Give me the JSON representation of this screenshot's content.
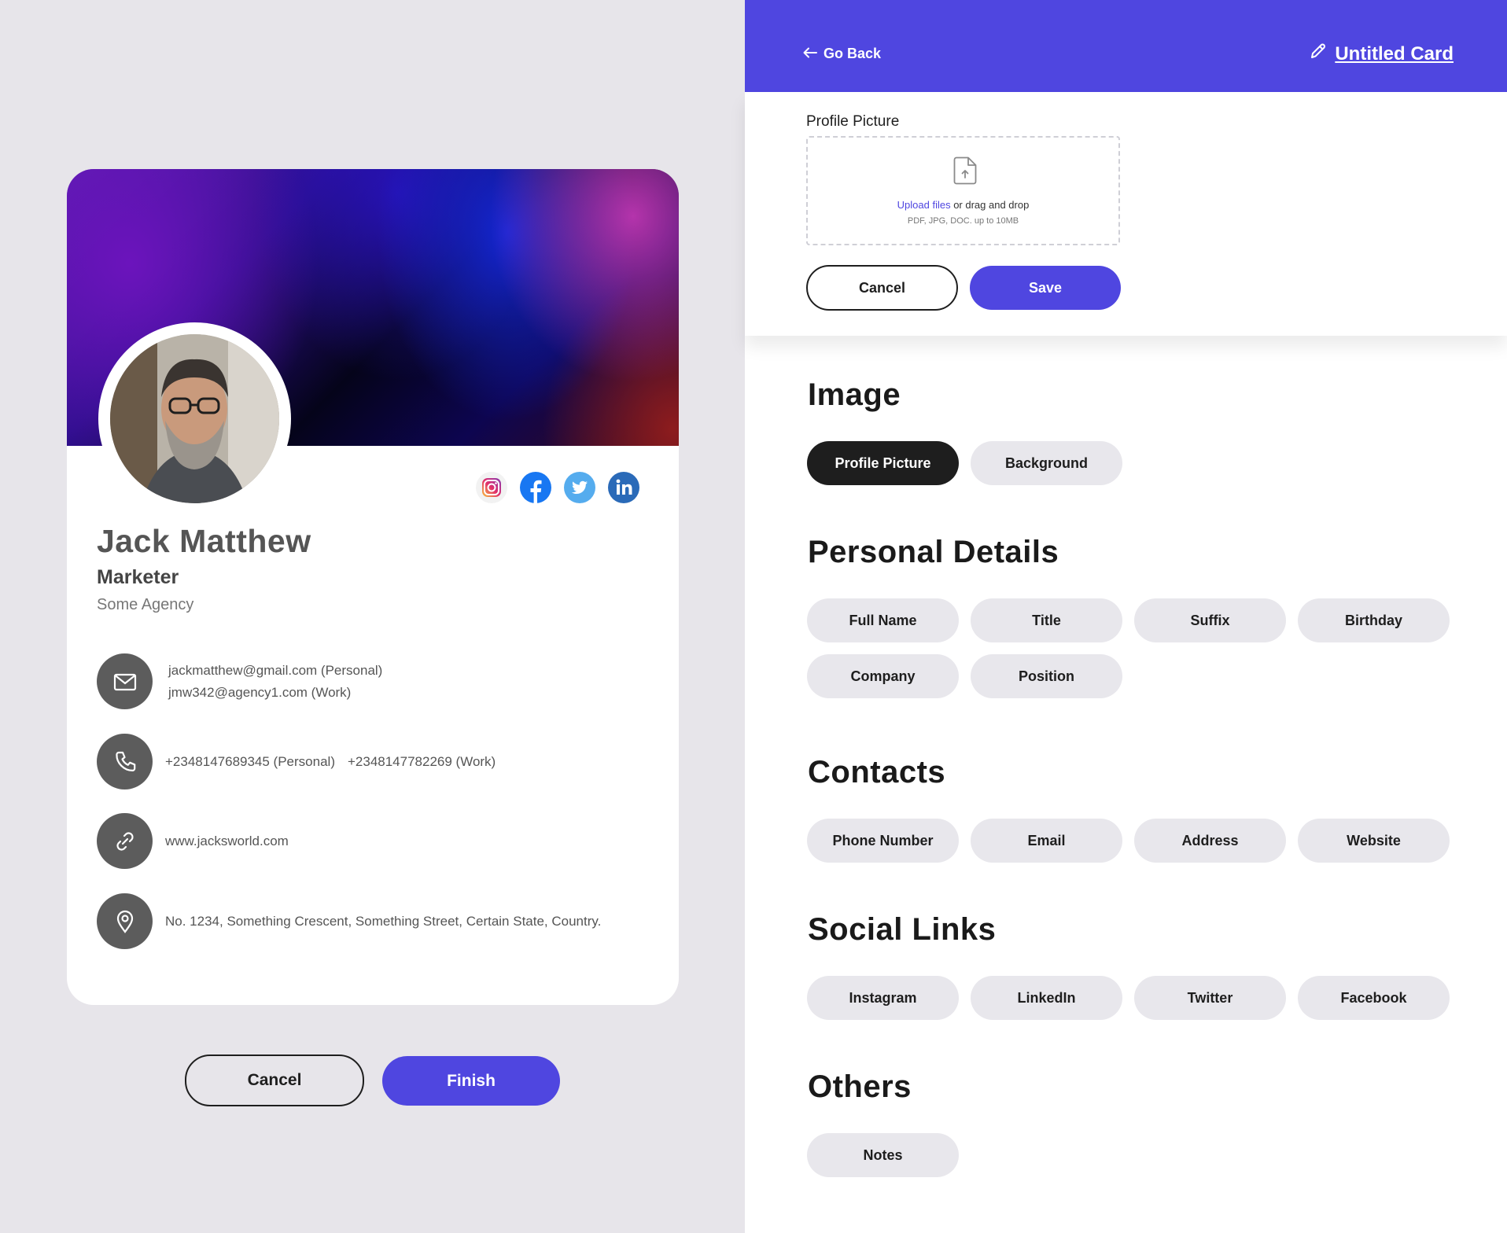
{
  "card": {
    "name": "Jack Matthew",
    "role": "Marketer",
    "agency": "Some Agency",
    "emails": [
      "jackmatthew@gmail.com (Personal)",
      "jmw342@agency1.com (Work)"
    ],
    "phones": [
      "+2348147689345 (Personal)",
      "+2348147782269 (Work)"
    ],
    "website": "www.jacksworld.com",
    "address": "No. 1234, Something Crescent, Something Street, Certain State, Country.",
    "socials": [
      "instagram-icon",
      "facebook-icon",
      "twitter-icon",
      "linkedin-icon"
    ]
  },
  "left_actions": {
    "cancel": "Cancel",
    "finish": "Finish"
  },
  "topbar": {
    "back": "Go Back",
    "title": "Untitled Card"
  },
  "upload": {
    "label": "Profile Picture",
    "link": "Upload files",
    "text": " or drag and drop",
    "hint": "PDF, JPG, DOC. up to 10MB",
    "cancel": "Cancel",
    "save": "Save"
  },
  "sections": {
    "image": {
      "title": "Image",
      "chips": [
        "Profile Picture",
        "Background"
      ],
      "active": "Profile Picture"
    },
    "personal": {
      "title": "Personal Details",
      "chips": [
        "Full Name",
        "Title",
        "Suffix",
        "Birthday",
        "Company",
        "Position"
      ]
    },
    "contacts": {
      "title": "Contacts",
      "chips": [
        "Phone Number",
        "Email",
        "Address",
        "Website"
      ]
    },
    "social": {
      "title": "Social Links",
      "chips": [
        "Instagram",
        "LinkedIn",
        "Twitter",
        "Facebook"
      ]
    },
    "others": {
      "title": "Others",
      "chips": [
        "Notes"
      ]
    }
  },
  "colors": {
    "accent": "#4f46e0",
    "dark": "#1e1e1e",
    "chip": "#e8e7ec",
    "icon_bg": "#5c5c5c"
  }
}
